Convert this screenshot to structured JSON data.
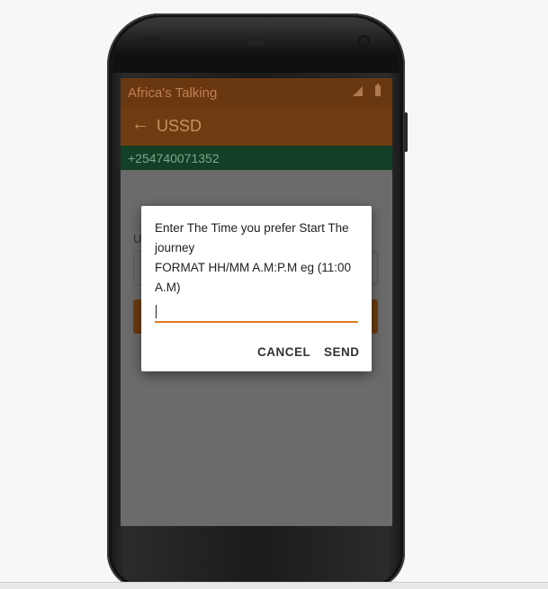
{
  "statusbar": {
    "app_name": "Africa's Talking"
  },
  "appbar": {
    "title": "USSD"
  },
  "phonebar": {
    "number": "+254740071352"
  },
  "background": {
    "label_fragment": "U"
  },
  "dialog": {
    "message_lines": [
      "Enter The Time you prefer Start The journey",
      "FORMAT HH/MM A.M:P.M eg (11:00 A.M)"
    ],
    "input_value": "",
    "cancel_label": "CANCEL",
    "send_label": "SEND"
  },
  "colors": {
    "accent": "#e07a1f",
    "appbar": "#6e3c10",
    "phonebar": "#123f25"
  }
}
